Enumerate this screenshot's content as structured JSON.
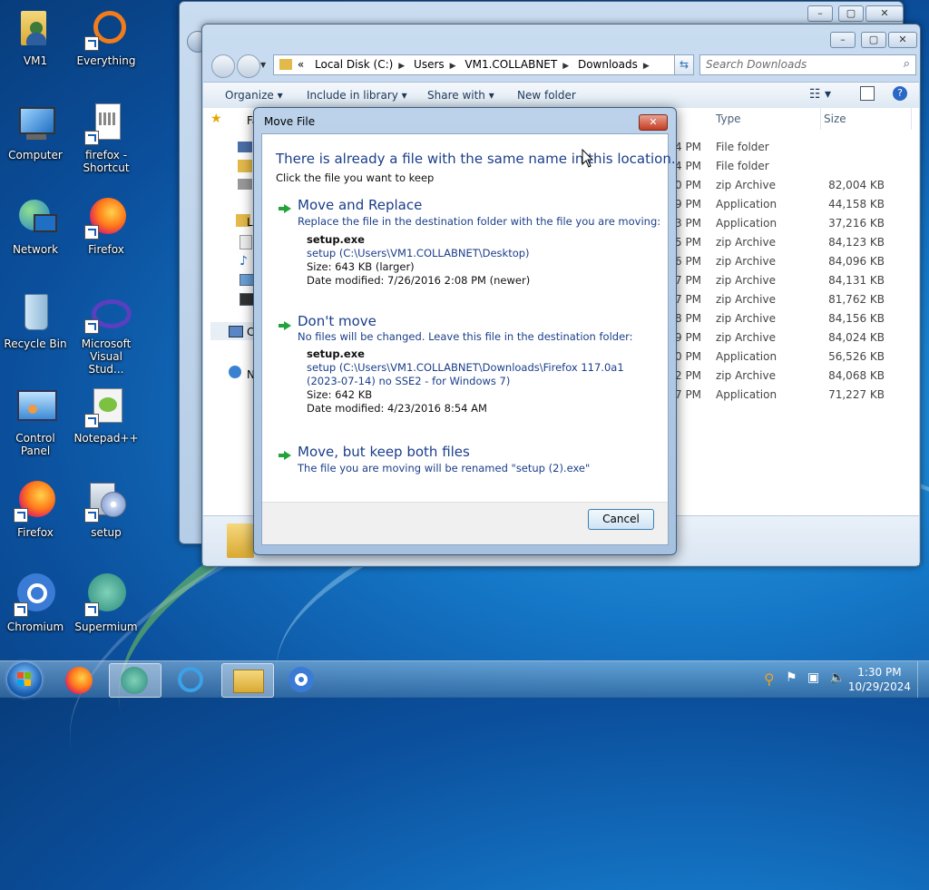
{
  "desktop": {
    "icons": [
      {
        "label": "VM1"
      },
      {
        "label": "Everything"
      },
      {
        "label": "Computer"
      },
      {
        "label": "firefox -\nShortcut"
      },
      {
        "label": "Network"
      },
      {
        "label": "Firefox"
      },
      {
        "label": "Recycle Bin"
      },
      {
        "label": "Microsoft\nVisual Stud..."
      },
      {
        "label": "Control Panel"
      },
      {
        "label": "Notepad++"
      },
      {
        "label": "Firefox"
      },
      {
        "label": "setup"
      },
      {
        "label": "Chromium"
      },
      {
        "label": "Supermium"
      }
    ]
  },
  "explorer": {
    "address": {
      "lead": "«",
      "crumbs": [
        "Local Disk (C:)",
        "Users",
        "VM1.COLLABNET",
        "Downloads"
      ]
    },
    "search_placeholder": "Search Downloads",
    "toolbar": {
      "organize": "Organize",
      "include": "Include in library",
      "share": "Share with",
      "new_folder": "New folder"
    },
    "nav_partial": {
      "fav": "Fa",
      "lib": "Li",
      "comp": "C",
      "net": "N"
    },
    "columns": {
      "type": "Type",
      "size": "Size"
    },
    "rows": [
      {
        "time": "4 PM",
        "type": "File folder",
        "size": ""
      },
      {
        "time": "4 PM",
        "type": "File folder",
        "size": ""
      },
      {
        "time": "0 PM",
        "type": "zip Archive",
        "size": "82,004 KB"
      },
      {
        "time": "9 PM",
        "type": "Application",
        "size": "44,158 KB"
      },
      {
        "time": "3 PM",
        "type": "Application",
        "size": "37,216 KB"
      },
      {
        "time": "5 PM",
        "type": "zip Archive",
        "size": "84,123 KB"
      },
      {
        "time": "6 PM",
        "type": "zip Archive",
        "size": "84,096 KB"
      },
      {
        "time": "7 PM",
        "type": "zip Archive",
        "size": "84,131 KB"
      },
      {
        "time": "7 PM",
        "type": "zip Archive",
        "size": "81,762 KB"
      },
      {
        "time": "8 PM",
        "type": "zip Archive",
        "size": "84,156 KB"
      },
      {
        "time": "9 PM",
        "type": "zip Archive",
        "size": "84,024 KB"
      },
      {
        "time": "0 PM",
        "type": "Application",
        "size": "56,526 KB"
      },
      {
        "time": "2 PM",
        "type": "zip Archive",
        "size": "84,068 KB"
      },
      {
        "time": "7 PM",
        "type": "Application",
        "size": "71,227 KB"
      }
    ]
  },
  "dialog": {
    "title": "Move File",
    "heading": "There is already a file with the same name in this location.",
    "subheading": "Click the file you want to keep",
    "replace": {
      "title": "Move and Replace",
      "desc": "Replace the file in the destination folder with the file you are moving:",
      "filename": "setup.exe",
      "path": "setup (C:\\Users\\VM1.COLLABNET\\Desktop)",
      "size": "Size: 643 KB (larger)",
      "date": "Date modified: 7/26/2016 2:08 PM (newer)"
    },
    "dontmove": {
      "title": "Don't move",
      "desc": "No files will be changed. Leave this file in the destination folder:",
      "filename": "setup.exe",
      "path1": "setup (C:\\Users\\VM1.COLLABNET\\Downloads\\Firefox 117.0a1",
      "path2": "(2023-07-14) no SSE2 - for Windows 7)",
      "size": "Size: 642 KB",
      "date": "Date modified: 4/23/2016 8:54 AM"
    },
    "keepboth": {
      "title": "Move, but keep both files",
      "desc": "The file you are moving will be renamed \"setup (2).exe\""
    },
    "cancel": "Cancel"
  },
  "taskbar": {
    "time": "1:30 PM",
    "date": "10/29/2024"
  }
}
